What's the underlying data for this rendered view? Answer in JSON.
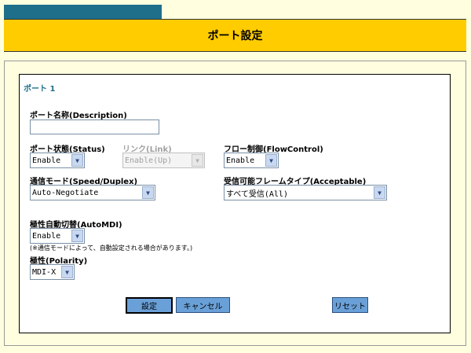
{
  "header": {
    "title": "ポート設定"
  },
  "port": {
    "title": "ポート 1"
  },
  "fields": {
    "description": {
      "label": "ポート名称(Description)",
      "value": ""
    },
    "status": {
      "label": "ポート状態(Status)",
      "value": "Enable"
    },
    "link": {
      "label": "リンク(Link)",
      "value": "Enable(Up)"
    },
    "flow_control": {
      "label": "フロー制御(FlowControl)",
      "value": "Enable"
    },
    "speed_duplex": {
      "label": "通信モード(Speed/Duplex)",
      "value": "Auto-Negotiate"
    },
    "acceptable": {
      "label": "受信可能フレームタイプ(Acceptable)",
      "value": "すべて受信(All)"
    },
    "auto_mdi": {
      "label": "極性自動切替(AutoMDI)",
      "value": "Enable",
      "note": "(※通信モードによって、自動設定される場合があります。)"
    },
    "polarity": {
      "label": "極性(Polarity)",
      "value": "MDI-X"
    }
  },
  "buttons": {
    "apply": "設定",
    "cancel": "キャンセル",
    "reset": "リセット"
  },
  "icons": {
    "dropdown": "chevron-down-icon"
  },
  "colors": {
    "title_bar": "#ffcc00",
    "tab": "#1f6f8b",
    "background": "#ffffe0",
    "button": "#6aa0d8"
  }
}
